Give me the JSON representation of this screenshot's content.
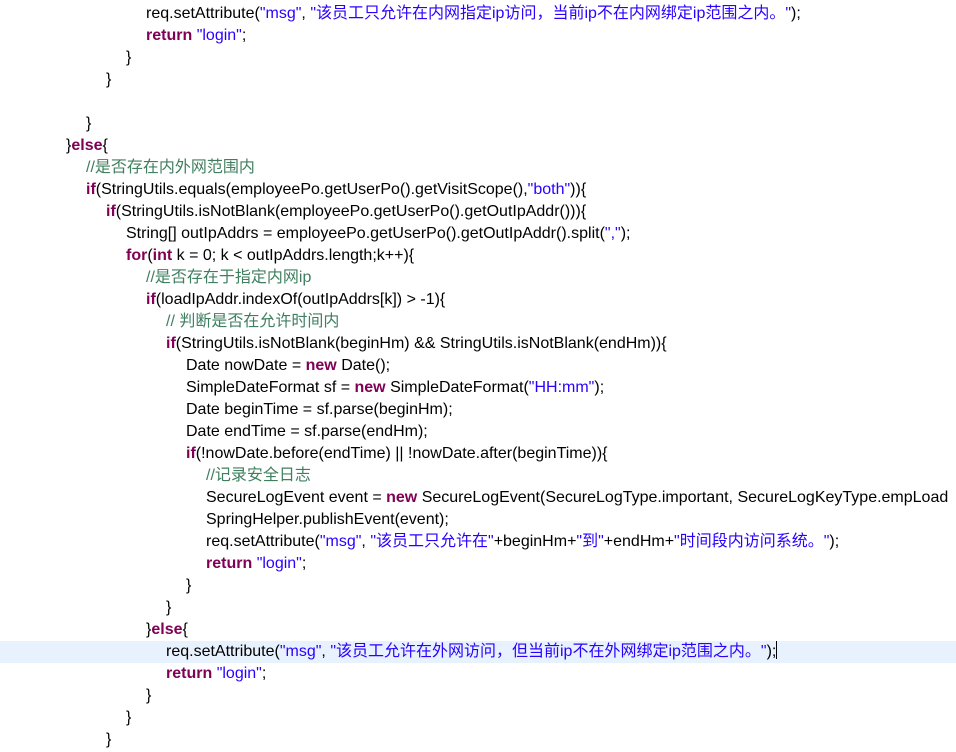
{
  "editor": {
    "lines": [
      {
        "indent": 7,
        "tokens": [
          {
            "t": "plain",
            "v": "req.setAttribute("
          },
          {
            "t": "str",
            "v": "\"msg\""
          },
          {
            "t": "plain",
            "v": ", "
          },
          {
            "t": "str",
            "v": "\"该员工只允许在内网指定ip访问，当前ip不在内网绑定ip范围之内。\""
          },
          {
            "t": "plain",
            "v": ");"
          }
        ]
      },
      {
        "indent": 7,
        "tokens": [
          {
            "t": "kw",
            "v": "return"
          },
          {
            "t": "plain",
            "v": " "
          },
          {
            "t": "str",
            "v": "\"login\""
          },
          {
            "t": "plain",
            "v": ";"
          }
        ]
      },
      {
        "indent": 6,
        "tokens": [
          {
            "t": "plain",
            "v": "}"
          }
        ]
      },
      {
        "indent": 5,
        "tokens": [
          {
            "t": "plain",
            "v": "}"
          }
        ]
      },
      {
        "indent": 0,
        "tokens": []
      },
      {
        "indent": 4,
        "tokens": [
          {
            "t": "plain",
            "v": "}"
          }
        ]
      },
      {
        "indent": 3,
        "tokens": [
          {
            "t": "plain",
            "v": "}"
          },
          {
            "t": "kw",
            "v": "else"
          },
          {
            "t": "plain",
            "v": "{"
          }
        ]
      },
      {
        "indent": 4,
        "tokens": [
          {
            "t": "cmt",
            "v": "//是否存在内外网范围内"
          }
        ]
      },
      {
        "indent": 4,
        "tokens": [
          {
            "t": "kw",
            "v": "if"
          },
          {
            "t": "plain",
            "v": "(StringUtils.equals(employeePo.getUserPo().getVisitScope(),"
          },
          {
            "t": "str",
            "v": "\"both\""
          },
          {
            "t": "plain",
            "v": ")){"
          }
        ]
      },
      {
        "indent": 5,
        "tokens": [
          {
            "t": "kw",
            "v": "if"
          },
          {
            "t": "plain",
            "v": "(StringUtils.isNotBlank(employeePo.getUserPo().getOutIpAddr())){"
          }
        ]
      },
      {
        "indent": 6,
        "tokens": [
          {
            "t": "plain",
            "v": "String[] outIpAddrs = employeePo.getUserPo().getOutIpAddr().split("
          },
          {
            "t": "str",
            "v": "\",\""
          },
          {
            "t": "plain",
            "v": ");"
          }
        ]
      },
      {
        "indent": 6,
        "tokens": [
          {
            "t": "kw",
            "v": "for"
          },
          {
            "t": "plain",
            "v": "("
          },
          {
            "t": "kw",
            "v": "int"
          },
          {
            "t": "plain",
            "v": " k = 0; k < outIpAddrs.length;k++){"
          }
        ]
      },
      {
        "indent": 7,
        "tokens": [
          {
            "t": "cmt",
            "v": "//是否存在于指定内网ip"
          }
        ]
      },
      {
        "indent": 7,
        "tokens": [
          {
            "t": "kw",
            "v": "if"
          },
          {
            "t": "plain",
            "v": "(loadIpAddr.indexOf(outIpAddrs[k]) > -1){"
          }
        ]
      },
      {
        "indent": 8,
        "tokens": [
          {
            "t": "cmt",
            "v": "// 判断是否在允许时间内"
          }
        ]
      },
      {
        "indent": 8,
        "tokens": [
          {
            "t": "kw",
            "v": "if"
          },
          {
            "t": "plain",
            "v": "(StringUtils.isNotBlank(beginHm) && StringUtils.isNotBlank(endHm)){"
          }
        ]
      },
      {
        "indent": 9,
        "tokens": [
          {
            "t": "plain",
            "v": "Date nowDate = "
          },
          {
            "t": "kw",
            "v": "new"
          },
          {
            "t": "plain",
            "v": " Date();"
          }
        ]
      },
      {
        "indent": 9,
        "tokens": [
          {
            "t": "plain",
            "v": "SimpleDateFormat sf = "
          },
          {
            "t": "kw",
            "v": "new"
          },
          {
            "t": "plain",
            "v": " SimpleDateFormat("
          },
          {
            "t": "str",
            "v": "\"HH:mm\""
          },
          {
            "t": "plain",
            "v": ");"
          }
        ]
      },
      {
        "indent": 9,
        "tokens": [
          {
            "t": "plain",
            "v": "Date beginTime = sf.parse(beginHm);"
          }
        ]
      },
      {
        "indent": 9,
        "tokens": [
          {
            "t": "plain",
            "v": "Date endTime = sf.parse(endHm);"
          }
        ]
      },
      {
        "indent": 9,
        "tokens": [
          {
            "t": "kw",
            "v": "if"
          },
          {
            "t": "plain",
            "v": "(!nowDate.before(endTime) || !nowDate.after(beginTime)){"
          }
        ]
      },
      {
        "indent": 10,
        "tokens": [
          {
            "t": "cmt",
            "v": "//记录安全日志"
          }
        ]
      },
      {
        "indent": 10,
        "tokens": [
          {
            "t": "plain",
            "v": "SecureLogEvent event = "
          },
          {
            "t": "kw",
            "v": "new"
          },
          {
            "t": "plain",
            "v": " SecureLogEvent(SecureLogType.important, SecureLogKeyType.empLoad"
          }
        ]
      },
      {
        "indent": 10,
        "tokens": [
          {
            "t": "plain",
            "v": "SpringHelper.publishEvent(event);"
          }
        ]
      },
      {
        "indent": 10,
        "tokens": [
          {
            "t": "plain",
            "v": "req.setAttribute("
          },
          {
            "t": "str",
            "v": "\"msg\""
          },
          {
            "t": "plain",
            "v": ", "
          },
          {
            "t": "str",
            "v": "\"该员工只允许在\""
          },
          {
            "t": "plain",
            "v": "+beginHm+"
          },
          {
            "t": "str",
            "v": "\"到\""
          },
          {
            "t": "plain",
            "v": "+endHm+"
          },
          {
            "t": "str",
            "v": "\"时间段内访问系统。\""
          },
          {
            "t": "plain",
            "v": ");"
          }
        ]
      },
      {
        "indent": 10,
        "tokens": [
          {
            "t": "kw",
            "v": "return"
          },
          {
            "t": "plain",
            "v": " "
          },
          {
            "t": "str",
            "v": "\"login\""
          },
          {
            "t": "plain",
            "v": ";"
          }
        ]
      },
      {
        "indent": 9,
        "tokens": [
          {
            "t": "plain",
            "v": "}"
          }
        ]
      },
      {
        "indent": 8,
        "tokens": [
          {
            "t": "plain",
            "v": "}"
          }
        ]
      },
      {
        "indent": 7,
        "tokens": [
          {
            "t": "plain",
            "v": "}"
          },
          {
            "t": "kw",
            "v": "else"
          },
          {
            "t": "plain",
            "v": "{"
          }
        ]
      },
      {
        "indent": 8,
        "current": true,
        "tokens": [
          {
            "t": "plain",
            "v": "req.setAttribute("
          },
          {
            "t": "str",
            "v": "\"msg\""
          },
          {
            "t": "plain",
            "v": ", "
          },
          {
            "t": "str",
            "v": "\"该员工允许在外网访问，但当前ip不在外网绑定ip范围之内。\""
          },
          {
            "t": "plain",
            "v": ");"
          },
          {
            "t": "caret",
            "v": ""
          }
        ]
      },
      {
        "indent": 8,
        "tokens": [
          {
            "t": "kw",
            "v": "return"
          },
          {
            "t": "plain",
            "v": " "
          },
          {
            "t": "str",
            "v": "\"login\""
          },
          {
            "t": "plain",
            "v": ";"
          }
        ]
      },
      {
        "indent": 7,
        "tokens": [
          {
            "t": "plain",
            "v": "}"
          }
        ]
      },
      {
        "indent": 6,
        "tokens": [
          {
            "t": "plain",
            "v": "}"
          }
        ]
      },
      {
        "indent": 5,
        "tokens": [
          {
            "t": "plain",
            "v": "}"
          }
        ]
      }
    ]
  },
  "colors": {
    "keyword": "#7f0055",
    "string": "#2a00ff",
    "comment": "#3f7f5f",
    "plain": "#000000",
    "current_line": "#e8f2fe"
  }
}
